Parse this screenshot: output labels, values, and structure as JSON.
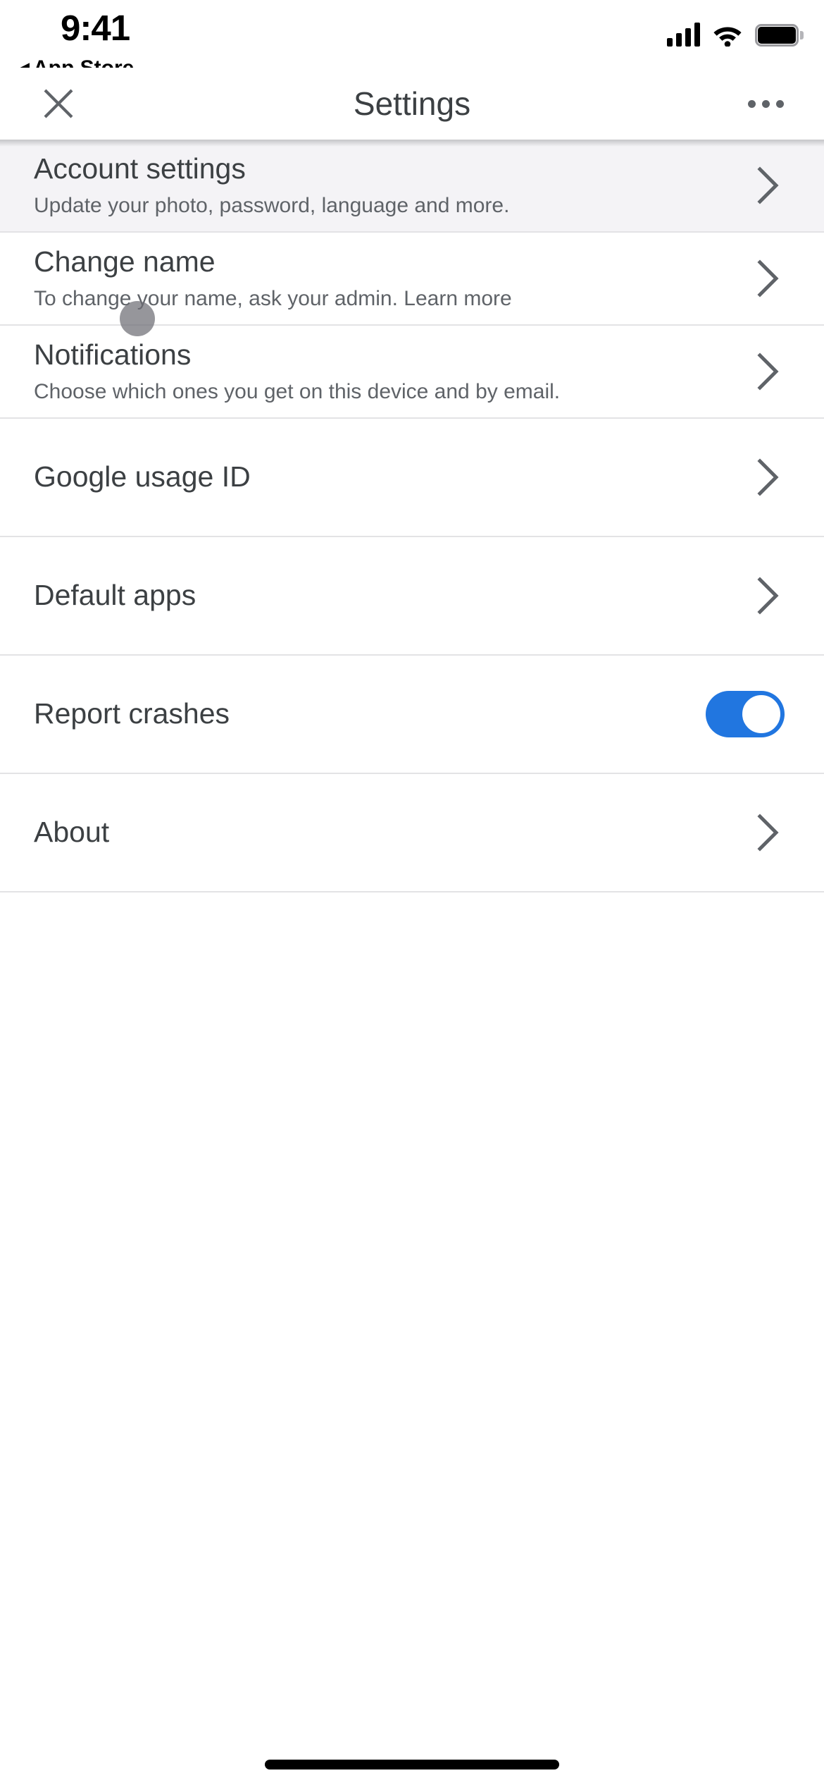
{
  "status_bar": {
    "time": "9:41",
    "back_arrow": "◀",
    "back_label": "App Store",
    "signal_icon": "cellular-signal-icon",
    "wifi_icon": "wifi-icon",
    "battery_icon": "battery-full-icon"
  },
  "header": {
    "close_icon": "close-icon",
    "title": "Settings",
    "overflow_icon": "overflow-menu-icon"
  },
  "colors": {
    "toggle_on": "#2176E0",
    "accent": "#1A73E8",
    "title_text": "#3C4043",
    "subtitle_text": "#5F6368",
    "divider": "#E3E3E5",
    "row_highlight": "#F4F3F6",
    "touch_indicator": "#6E6E74"
  },
  "rows": [
    {
      "title": "Account settings",
      "subtitle": "Update your photo, password, language and more.",
      "accessory": "chevron",
      "highlighted": true
    },
    {
      "title": "Change name",
      "subtitle": "To change your name, ask your admin. Learn more",
      "accessory": "chevron",
      "highlighted": false
    },
    {
      "title": "Notifications",
      "subtitle": "Choose which ones you get on this device and by email.",
      "accessory": "chevron",
      "highlighted": false
    },
    {
      "title": "Google usage ID",
      "subtitle": "",
      "accessory": "chevron",
      "highlighted": false
    },
    {
      "title": "Default apps",
      "subtitle": "",
      "accessory": "chevron",
      "highlighted": false
    },
    {
      "title": "Report crashes",
      "subtitle": "",
      "accessory": "toggle",
      "toggle_on": true,
      "highlighted": false
    },
    {
      "title": "About",
      "subtitle": "",
      "accessory": "chevron",
      "highlighted": false
    }
  ],
  "touch_indicator": {
    "visible": true,
    "label": "touch-point-indicator"
  },
  "home_indicator": {
    "label": "home-indicator"
  }
}
